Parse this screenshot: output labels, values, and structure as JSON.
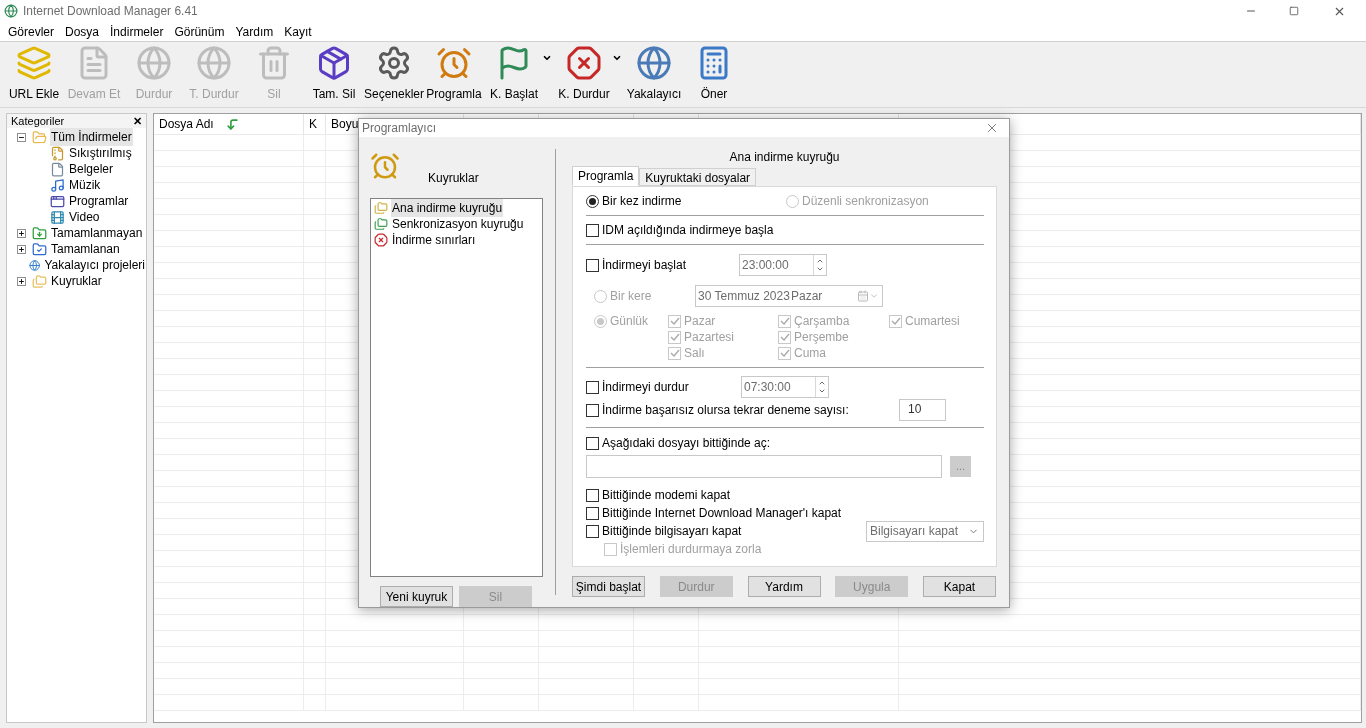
{
  "window": {
    "title": "Internet Download Manager 6.41"
  },
  "menu": [
    "Görevler",
    "Dosya",
    "İndirmeler",
    "Görünüm",
    "Yardım",
    "Kayıt"
  ],
  "toolbar": [
    {
      "label": "URL Ekle",
      "disabled": false,
      "dropdown": false
    },
    {
      "label": "Devam Et",
      "disabled": true,
      "dropdown": false
    },
    {
      "label": "Durdur",
      "disabled": true,
      "dropdown": false
    },
    {
      "label": "T. Durdur",
      "disabled": true,
      "dropdown": false
    },
    {
      "label": "Sil",
      "disabled": true,
      "dropdown": false
    },
    {
      "label": "Tam. Sil",
      "disabled": false,
      "dropdown": false
    },
    {
      "label": "Seçenekler",
      "disabled": false,
      "dropdown": false
    },
    {
      "label": "Programla",
      "disabled": false,
      "dropdown": false
    },
    {
      "label": "K. Başlat",
      "disabled": false,
      "dropdown": true
    },
    {
      "label": "K. Durdur",
      "disabled": false,
      "dropdown": true
    },
    {
      "label": "Yakalayıcı",
      "disabled": false,
      "dropdown": false
    },
    {
      "label": "Öner",
      "disabled": false,
      "dropdown": false
    }
  ],
  "sidebar": {
    "title": "Kategoriler",
    "close": "✕",
    "items": [
      {
        "label": "Tüm İndirmeler",
        "selected": true,
        "expanded": true,
        "children": [
          {
            "label": "Sıkıştırılmış",
            "selected": false
          },
          {
            "label": "Belgeler",
            "selected": false
          },
          {
            "label": "Müzik",
            "selected": false
          },
          {
            "label": "Programlar",
            "selected": false
          },
          {
            "label": "Video",
            "selected": false
          }
        ]
      },
      {
        "label": "Tamamlanmayan",
        "selected": false,
        "expanded": false
      },
      {
        "label": "Tamamlanan",
        "selected": false,
        "expanded": false
      },
      {
        "label": "Yakalayıcı projeleri",
        "selected": false
      },
      {
        "label": "Kuyruklar",
        "selected": false,
        "expanded": false
      }
    ]
  },
  "table": {
    "columns": [
      "Dosya Adı",
      "K",
      "Boyu"
    ]
  },
  "dialog": {
    "title": "Programlayıcı",
    "queues_title": "Kuyruklar",
    "queues": [
      {
        "label": "Ana indirme kuyruğu",
        "selected": true
      },
      {
        "label": "Senkronizasyon kuyruğu",
        "selected": false
      },
      {
        "label": "İndirme sınırları",
        "selected": false
      }
    ],
    "queue_buttons": [
      {
        "label": "Yeni kuyruk",
        "disabled": false
      },
      {
        "label": "Sil",
        "disabled": true
      }
    ],
    "heading": "Ana indirme kuyruğu",
    "tabs": [
      {
        "label": "Programla",
        "selected": true
      },
      {
        "label": "Kuyruktaki dosyalar",
        "selected": false
      }
    ],
    "modes": [
      {
        "label": "Bir kez indirme",
        "selected": true,
        "disabled": false
      },
      {
        "label": "Düzenli senkronizasyon",
        "selected": false,
        "disabled": true
      }
    ],
    "start_on_open": {
      "label": "IDM açıldığında indirmeye başla",
      "checked": false
    },
    "start": {
      "label": "İndirmeyi başlat",
      "checked": false,
      "time": "23:00:00"
    },
    "once": {
      "label": "Bir kere",
      "selected": false,
      "date": "30 Temmuz 2023",
      "day": "Pazar"
    },
    "daily": {
      "label": "Günlük",
      "selected": true,
      "days": [
        {
          "label": "Pazar",
          "checked": true
        },
        {
          "label": "Pazartesi",
          "checked": true
        },
        {
          "label": "Salı",
          "checked": true
        },
        {
          "label": "Çarşamba",
          "checked": true
        },
        {
          "label": "Perşembe",
          "checked": true
        },
        {
          "label": "Cuma",
          "checked": true
        },
        {
          "label": "Cumartesi",
          "checked": true
        }
      ]
    },
    "stop": {
      "label": "İndirmeyi durdur",
      "checked": false,
      "time": "07:30:00"
    },
    "retry": {
      "label": "İndirme başarısız olursa tekrar deneme sayısı:",
      "checked": false,
      "value": "10"
    },
    "open_file": {
      "label": "Aşağıdaki dosyayı bittiğinde aç:",
      "checked": false,
      "browse": "..."
    },
    "finish_options": [
      {
        "label": "Bittiğinde modemi kapat",
        "checked": false
      },
      {
        "label": "Bittiğinde Internet Download Manager'ı kapat",
        "checked": false
      },
      {
        "label": "Bittiğinde bilgisayarı kapat",
        "checked": false
      }
    ],
    "shutdown_mode": "Bilgisayarı kapat",
    "force": {
      "label": "İşlemleri durdurmaya zorla",
      "checked": false,
      "disabled": true
    },
    "buttons": [
      {
        "label": "Şimdi başlat",
        "disabled": false
      },
      {
        "label": "Durdur",
        "disabled": true
      },
      {
        "label": "Yardım",
        "disabled": false
      },
      {
        "label": "Uygula",
        "disabled": true
      },
      {
        "label": "Kapat",
        "disabled": false
      }
    ]
  }
}
